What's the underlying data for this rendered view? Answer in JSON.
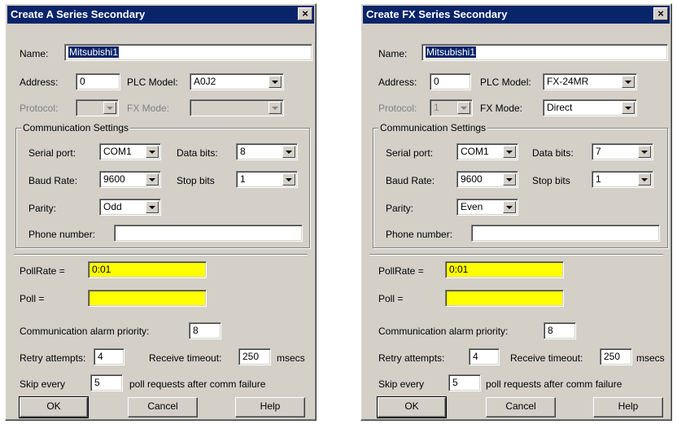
{
  "dialogs": [
    {
      "title": "Create A Series Secondary",
      "name_label": "Name:",
      "name_value": "Mitsubishi1",
      "address_label": "Address:",
      "address_value": "0",
      "plc_model_label": "PLC Model:",
      "plc_model_value": "A0J2",
      "protocol_label": "Protocol:",
      "protocol_value": "",
      "fx_mode_label": "FX Mode:",
      "fx_mode_value": "",
      "comm_group": "Communication Settings",
      "serial_port_label": "Serial port:",
      "serial_port_value": "COM1",
      "data_bits_label": "Data bits:",
      "data_bits_value": "8",
      "baud_rate_label": "Baud Rate:",
      "baud_rate_value": "9600",
      "stop_bits_label": "Stop bits",
      "stop_bits_value": "1",
      "parity_label": "Parity:",
      "parity_value": "Odd",
      "phone_label": "Phone number:",
      "phone_value": "",
      "pollrate_label": "PollRate =",
      "pollrate_value": "0:01",
      "poll_label": "Poll =",
      "poll_value": "",
      "alarm_label": "Communication alarm priority:",
      "alarm_value": "8",
      "retry_label": "Retry attempts:",
      "retry_value": "4",
      "timeout_label": "Receive timeout:",
      "timeout_value": "250",
      "msecs": "msecs",
      "skip_label": "Skip every",
      "skip_value": "5",
      "skip_suffix": "poll requests after comm failure",
      "ok": "OK",
      "cancel": "Cancel",
      "help": "Help"
    },
    {
      "title": "Create FX Series Secondary",
      "name_label": "Name:",
      "name_value": "Mitsubishi1",
      "address_label": "Address:",
      "address_value": "0",
      "plc_model_label": "PLC Model:",
      "plc_model_value": "FX-24MR",
      "protocol_label": "Protocol:",
      "protocol_value": "1",
      "fx_mode_label": "FX Mode:",
      "fx_mode_value": "Direct",
      "comm_group": "Communication Settings",
      "serial_port_label": "Serial port:",
      "serial_port_value": "COM1",
      "data_bits_label": "Data bits:",
      "data_bits_value": "7",
      "baud_rate_label": "Baud Rate:",
      "baud_rate_value": "9600",
      "stop_bits_label": "Stop bits",
      "stop_bits_value": "1",
      "parity_label": "Parity:",
      "parity_value": "Even",
      "phone_label": "Phone number:",
      "phone_value": "",
      "pollrate_label": "PollRate =",
      "pollrate_value": "0:01",
      "poll_label": "Poll =",
      "poll_value": "",
      "alarm_label": "Communication alarm priority:",
      "alarm_value": "8",
      "retry_label": "Retry attempts:",
      "retry_value": "4",
      "timeout_label": "Receive timeout:",
      "timeout_value": "250",
      "msecs": "msecs",
      "skip_label": "Skip every",
      "skip_value": "5",
      "skip_suffix": "poll requests after comm failure",
      "ok": "OK",
      "cancel": "Cancel",
      "help": "Help"
    }
  ],
  "colors": {
    "titlebar": "#0a246a",
    "dialog_face": "#d4d0c8",
    "highlight_field": "#ffff00"
  }
}
